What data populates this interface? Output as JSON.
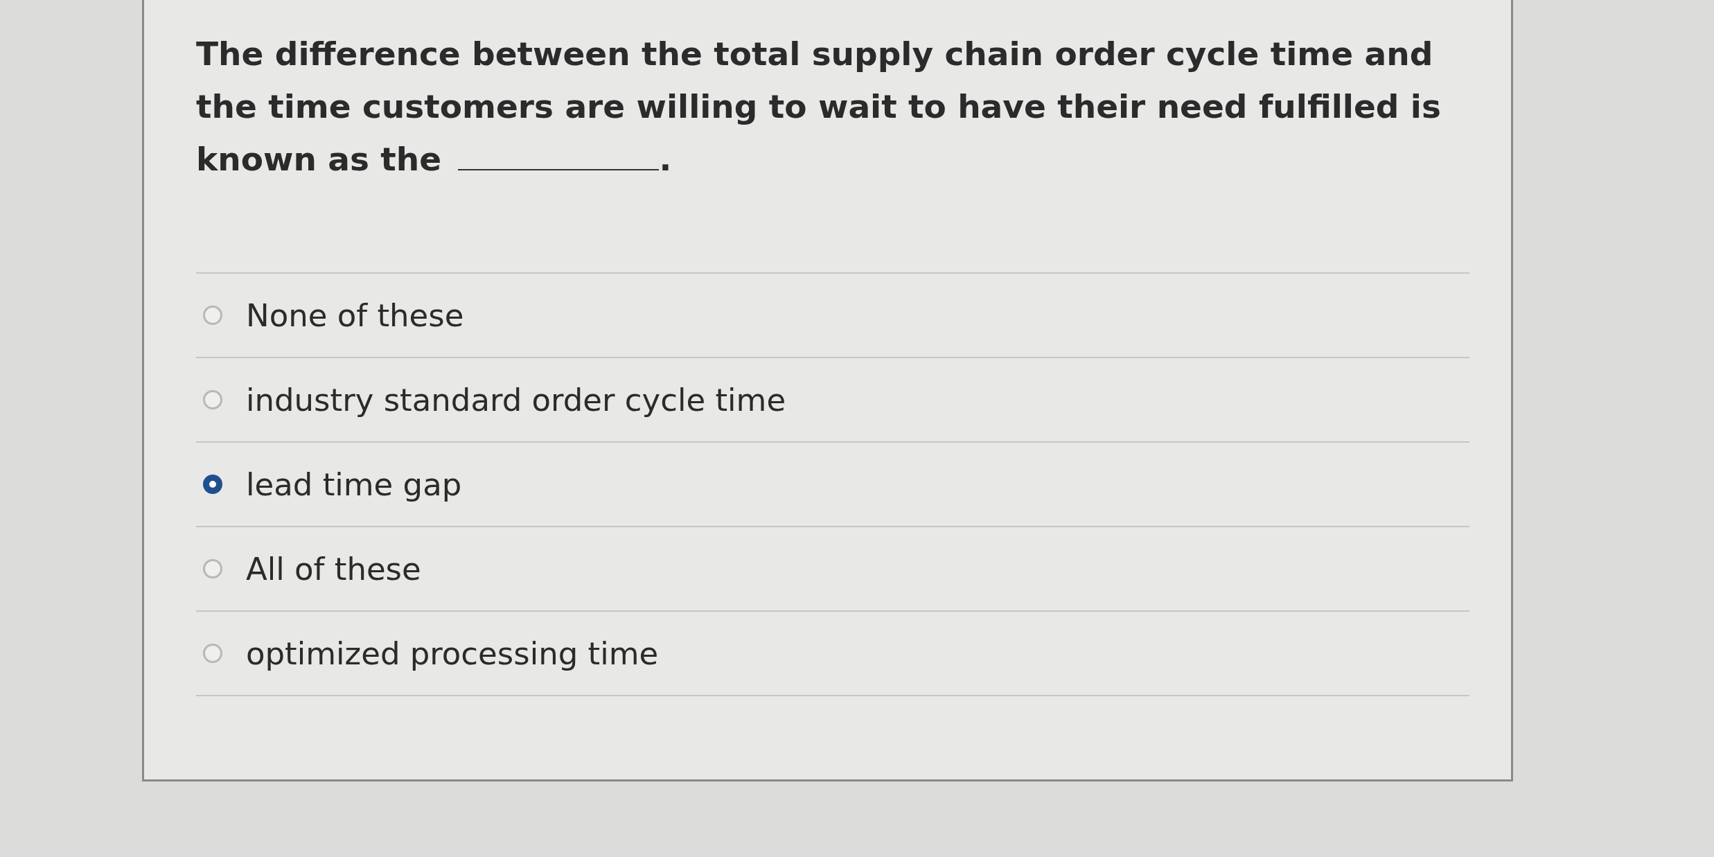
{
  "question": {
    "text": "The difference between the total supply chain order cycle time and the time customers are willing to wait to have their need fulfilled is known as the",
    "after_blank": "."
  },
  "options": [
    {
      "label": "None of these",
      "selected": false
    },
    {
      "label": "industry standard order cycle time",
      "selected": false
    },
    {
      "label": "lead time gap",
      "selected": true
    },
    {
      "label": "All of these",
      "selected": false
    },
    {
      "label": "optimized processing time",
      "selected": false
    }
  ]
}
